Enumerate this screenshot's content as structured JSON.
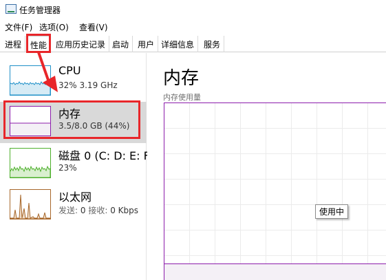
{
  "window": {
    "title": "任务管理器",
    "icon": "task-manager-icon"
  },
  "menu": {
    "items": [
      "文件(F)",
      "选项(O)",
      "查看(V)"
    ]
  },
  "tabs": [
    "进程",
    "性能",
    "应用历史记录",
    "启动",
    "用户",
    "详细信息",
    "服务"
  ],
  "active_tab": "性能",
  "sidebar": {
    "items": [
      {
        "title": "CPU",
        "detail": "32%  3.19 GHz",
        "color": "#1e90c8"
      },
      {
        "title": "内存",
        "detail": "3.5/8.0 GB (44%)",
        "color": "#8b1bab",
        "selected": true
      },
      {
        "title": "磁盘 0 (C: D: E: F:",
        "detail": "23%",
        "color": "#4caf2a"
      },
      {
        "title": "以太网",
        "detail_send_label": "发送:",
        "detail_send": "0",
        "detail_recv_label": "接收:",
        "detail_recv": "0 Kbps",
        "color": "#a7672a"
      }
    ]
  },
  "main": {
    "title": "内存",
    "graph_label": "内存使用量",
    "tooltip": "使用中",
    "memory_used_fraction": 0.44
  },
  "colors": {
    "highlight_red": "#e8262a",
    "memory_purple": "#8b1bab"
  }
}
